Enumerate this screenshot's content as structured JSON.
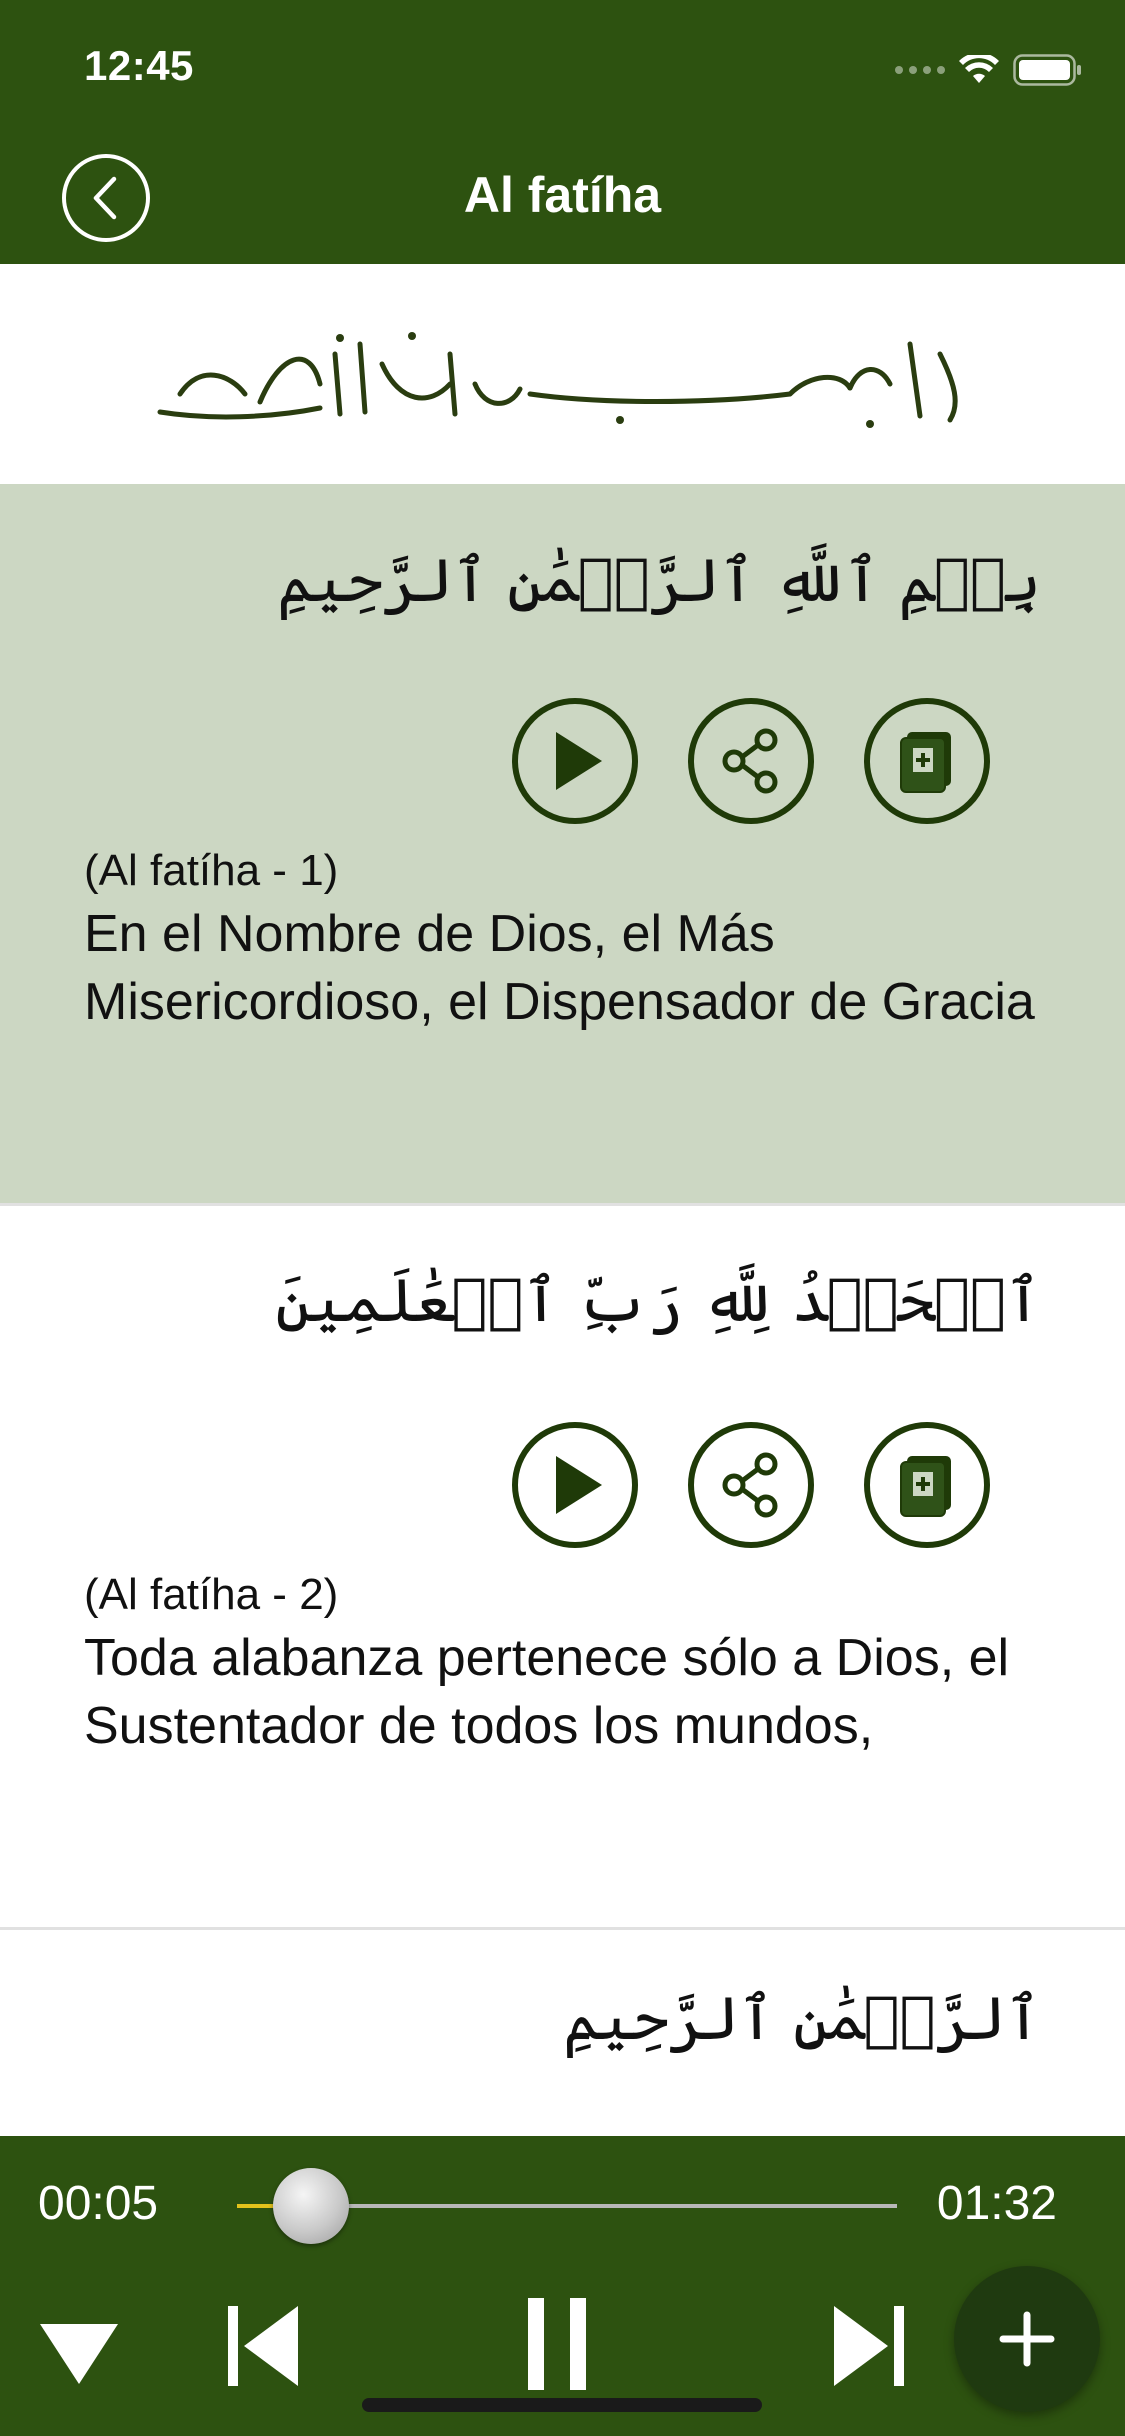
{
  "status_bar": {
    "time": "12:45"
  },
  "header": {
    "title": "Al fatíha",
    "back_icon": "chevron-left-icon"
  },
  "colors": {
    "header_bg": "#2d5210",
    "highlight_bg": "#ccd7c3",
    "accent_dark": "#1f3a08",
    "progress_fill": "#e3c21c"
  },
  "verses": [
    {
      "arabic": "بِسۡمِ ٱللَّهِ ٱلرَّحۡمَٰنِ ٱلرَّحِيمِ",
      "reference": "(Al fatíha - 1)",
      "translation": "En el Nombre de Dios, el Más Misericordioso, el Dispensador de Gracia",
      "highlighted": true
    },
    {
      "arabic": "ٱلۡحَمۡدُ لِلَّهِ رَبِّ ٱلۡعَٰلَمِينَ",
      "reference": "(Al fatíha - 2)",
      "translation": "Toda alabanza pertenece sólo a Dios, el Sustentador de todos los mundos,",
      "highlighted": false
    },
    {
      "arabic": "ٱلرَّحۡمَٰنِ ٱلرَّحِيمِ"
    }
  ],
  "player": {
    "elapsed": "00:05",
    "total": "01:32",
    "progress": 0.054
  }
}
